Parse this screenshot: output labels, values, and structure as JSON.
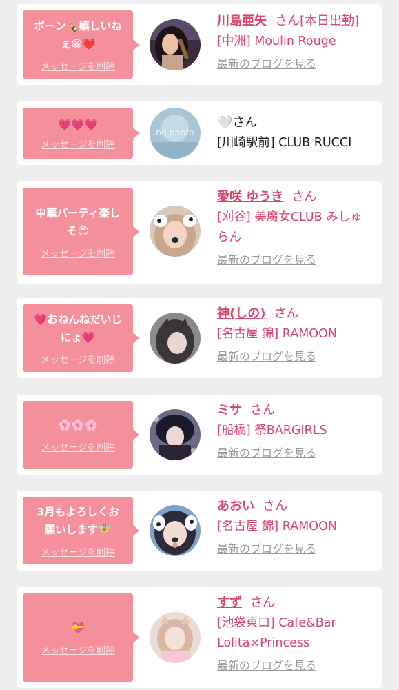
{
  "delete_label": "メッセージを削除",
  "blog_label": "最新のブログを見る",
  "san_label": "さん",
  "colors": {
    "pink_bubble": "#f4909c",
    "name_pink": "#d9466b",
    "background": "#efefef"
  },
  "items": [
    {
      "message": "ポーン🍾嬉しいねぇ😁❤️",
      "name": "川島亜矢",
      "san": "さん",
      "status": "[本日出勤]",
      "shop": "[中洲] Moulin Rouge",
      "has_blog": true
    },
    {
      "message": "💗💗💗",
      "name": "",
      "name_prefix": "🤍",
      "san": "さん",
      "shop": "[川崎駅前] CLUB RUCCI",
      "has_blog": false,
      "avatar_text": "no photo"
    },
    {
      "message": "中華パーティ楽しそ😍",
      "name": "愛咲 ゆうき",
      "san": "さん",
      "shop": "[刈谷] 美魔女CLUB みしゅらん",
      "has_blog": true
    },
    {
      "message": "💗おねんねだいじにょ💗",
      "name": "神(しの)",
      "san": "さん",
      "shop": "[名古屋 錦] RAMOON",
      "has_blog": true
    },
    {
      "message": "🌸🌸🌸",
      "name": "ミサ",
      "san": "さん",
      "shop": "[船橋] 祭BARGIRLS",
      "has_blog": true
    },
    {
      "message": "3月もよろしくお願いします🧚",
      "name": "あおい",
      "san": "さん",
      "shop": "[名古屋 錦] RAMOON",
      "has_blog": true
    },
    {
      "message": "💝",
      "name": "すず",
      "san": "さん",
      "shop": "[池袋東口] Cafe&Bar Lolita×Princess",
      "has_blog": true
    }
  ]
}
